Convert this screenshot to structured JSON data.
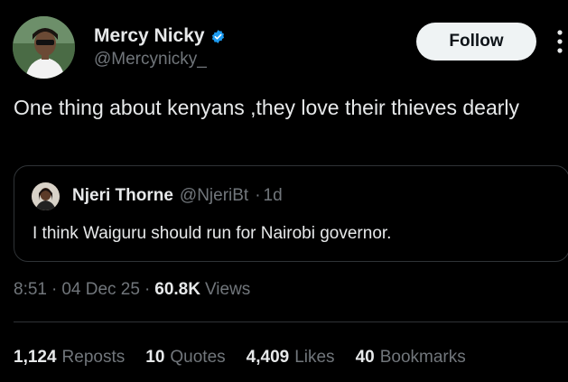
{
  "author": {
    "name": "Mercy Nicky",
    "handle": "@Mercynicky_",
    "verified_color": "#1d9bf0"
  },
  "follow_label": "Follow",
  "icons": {
    "more": "more-vertical-icon",
    "verified": "verified-badge-icon"
  },
  "tweet": {
    "text": "One thing about kenyans ,they love their thieves dearly"
  },
  "quote": {
    "name": "Njeri Thorne",
    "handle": "@NjeriBt",
    "separator": "·",
    "age": "1d",
    "text": "I think Waiguru should run for Nairobi governor."
  },
  "meta": {
    "time": "8:51",
    "sep1": "·",
    "date": "04 Dec 25",
    "sep2": "·",
    "views_count": "60.8K",
    "views_label": "Views"
  },
  "stats": [
    {
      "num": "1,124",
      "label": "Reposts"
    },
    {
      "num": "10",
      "label": "Quotes"
    },
    {
      "num": "4,409",
      "label": "Likes"
    },
    {
      "num": "40",
      "label": "Bookmarks"
    }
  ]
}
